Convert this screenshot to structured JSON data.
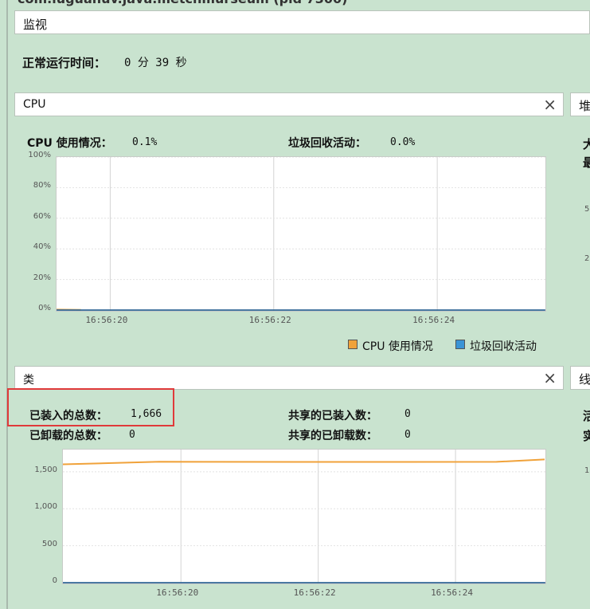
{
  "window": {
    "title_fragment": "com.luguanuv.java.metchmurseum (pid 7300)"
  },
  "tabs": [
    {
      "label": "监视"
    }
  ],
  "uptime": {
    "label": "正常运行时间：",
    "value": "0 分 39 秒"
  },
  "cpu_panel": {
    "title": "CPU",
    "close": "×",
    "stats": [
      {
        "label": "CPU 使用情况：",
        "value": "0.1%"
      },
      {
        "label": "垃圾回收活动：",
        "value": "0.0%"
      }
    ],
    "legend": [
      {
        "label": "CPU 使用情况",
        "color": "#f0a23a"
      },
      {
        "label": "垃圾回收活动",
        "color": "#3b94d6"
      }
    ]
  },
  "heap_panel": {
    "title": "堆",
    "partial_text": [
      "大",
      "最"
    ],
    "partial_ticks": [
      "5",
      "2"
    ]
  },
  "classes_panel": {
    "title": "类",
    "close": "×",
    "stats": [
      {
        "label": "已装入的总数：",
        "value": "1,666"
      },
      {
        "label": "共享的已装入数：",
        "value": "0"
      },
      {
        "label": "已卸载的总数：",
        "value": "0"
      },
      {
        "label": "共享的已卸载数：",
        "value": "0"
      }
    ]
  },
  "threads_panel": {
    "title": "线",
    "partial_text": [
      "活",
      "实"
    ],
    "partial_ticks": [
      "1"
    ]
  },
  "chart_data": [
    {
      "type": "line",
      "yticks": [
        "100%",
        "80%",
        "60%",
        "40%",
        "20%",
        "0%"
      ],
      "ylim": [
        0,
        100
      ],
      "xticks": [
        "16:56:20",
        "16:56:22",
        "16:56:24"
      ],
      "series": [
        {
          "name": "CPU 使用情况",
          "color": "#f0a23a",
          "x": [
            0,
            0.05
          ],
          "values": [
            0.3,
            0.1
          ]
        },
        {
          "name": "垃圾回收活动",
          "color": "#3b94d6",
          "x": [
            0,
            1
          ],
          "values": [
            0,
            0
          ]
        }
      ]
    },
    {
      "type": "line",
      "yticks": [
        "1,500",
        "1,000",
        "500",
        "0"
      ],
      "ylim": [
        0,
        1800
      ],
      "xticks": [
        "16:56:20",
        "16:56:22",
        "16:56:24"
      ],
      "series": [
        {
          "color": "#f0a23a",
          "x": [
            0,
            0.2,
            0.6,
            0.9,
            1
          ],
          "values": [
            1600,
            1635,
            1633,
            1634,
            1666
          ]
        },
        {
          "color": "#3b94d6",
          "x": [
            0,
            1
          ],
          "values": [
            0,
            0
          ]
        }
      ]
    }
  ]
}
